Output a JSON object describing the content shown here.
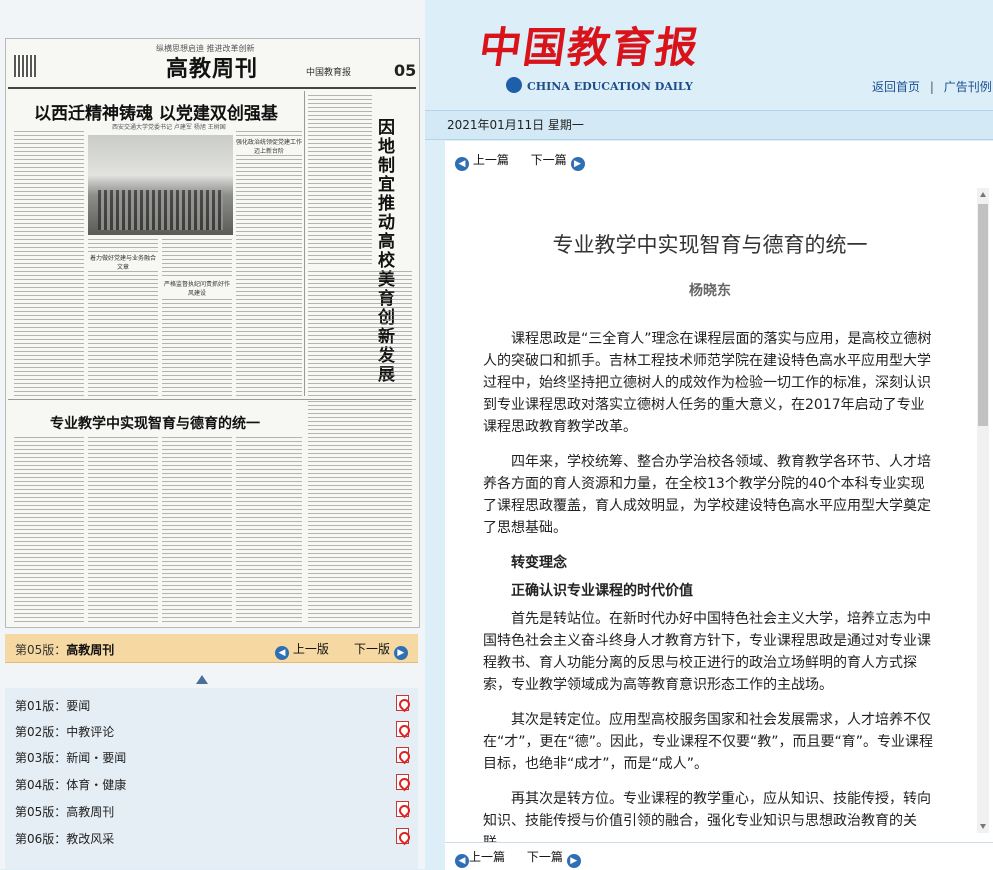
{
  "paper": {
    "slogan": "纵横思想启迪  推进改革创新",
    "section_title": "高教周刊",
    "page_no": "05",
    "masthead": "中国教育报",
    "headline_main": "以西迁精神铸魂  以党建双创强基",
    "byline_main": "西安交通大学党委书记 卢建军 杨旭 王树国",
    "vertical_headline": "因地制宜推动高校美育创新发展",
    "headline_second": "专业教学中实现智育与德育的统一",
    "sub_heads": [
      "强化政治统领促党建工作迈上新台阶",
      "着力做好党建与业务融合文章",
      "严格监督执纪问责抓好作风建设"
    ]
  },
  "edition_bar": {
    "label_prefix": "第05版：",
    "label": "高教周刊",
    "prev": "上一版",
    "next": "下一版"
  },
  "editions": [
    {
      "no": "第01版：",
      "name": "要闻"
    },
    {
      "no": "第02版：",
      "name": "中教评论"
    },
    {
      "no": "第03版：",
      "name": "新闻・要闻"
    },
    {
      "no": "第04版：",
      "name": "体育・健康"
    },
    {
      "no": "第05版：",
      "name": "高教周刊"
    },
    {
      "no": "第06版：",
      "name": "教改风采"
    }
  ],
  "header": {
    "logo_cn": "中国教育报",
    "logo_en": "CHINA EDUCATION DAILY",
    "home_link": "返回首页",
    "separator": "|",
    "ad_link": "广告刊例"
  },
  "date": "2021年01月11日  星期一",
  "article_nav": {
    "prev": "上一篇",
    "next": "下一篇"
  },
  "article": {
    "title": "专业教学中实现智育与德育的统一",
    "author": "杨晓东",
    "paragraphs": [
      {
        "type": "p",
        "text": "课程思政是“三全育人”理念在课程层面的落实与应用，是高校立德树人的突破口和抓手。吉林工程技术师范学院在建设特色高水平应用型大学过程中，始终坚持把立德树人的成效作为检验一切工作的标准，深刻认识到专业课程思政对落实立德树人任务的重大意义，在2017年启动了专业课程思政教育教学改革。"
      },
      {
        "type": "p",
        "text": "四年来，学校统筹、整合办学治校各领域、教育教学各环节、人才培养各方面的育人资源和力量，在全校13个教学分院的40个本科专业实现了课程思政覆盖，育人成效明显，为学校建设特色高水平应用型大学奠定了思想基础。"
      },
      {
        "type": "h",
        "text": "转变理念"
      },
      {
        "type": "h",
        "text": "正确认识专业课程的时代价值"
      },
      {
        "type": "p",
        "text": "首先是转站位。在新时代办好中国特色社会主义大学，培养立志为中国特色社会主义奋斗终身人才教育方针下，专业课程思政是通过对专业课程教书、育人功能分离的反思与校正进行的政治立场鲜明的育人方式探索，专业教学领域成为高等教育意识形态工作的主战场。"
      },
      {
        "type": "p",
        "text": "其次是转定位。应用型高校服务国家和社会发展需求，人才培养不仅在“才”，更在“德”。因此，专业课程不仅要“教”，而且要“育”。专业课程目标，也绝非“成才”，而是“成人”。"
      },
      {
        "type": "p",
        "text": "再其次是转方位。专业课程的教学重心，应从知识、技能传授，转向知识、技能传授与价值引领的融合，强化专业知识与思想政治教育的关联。"
      }
    ]
  },
  "colors": {
    "logo_red": "#d8141a",
    "link_blue": "#1b4f91",
    "edition_bar": "#f6d9a2",
    "date_bar": "#d3e9f6"
  }
}
